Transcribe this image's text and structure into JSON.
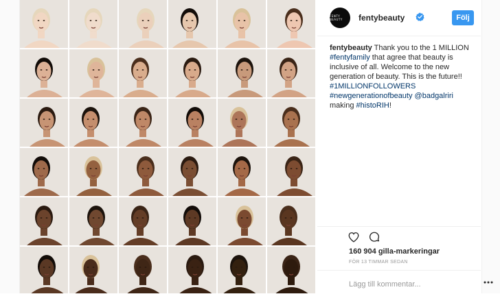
{
  "post": {
    "username": "fentybeauty",
    "avatar_text": "FENTY BEAUTY",
    "follow_label": "Följ",
    "caption": {
      "author": "fentybeauty",
      "segments": [
        {
          "text": " Thank you to the 1 MILLION ",
          "type": "text"
        },
        {
          "text": "#fentyfamily",
          "type": "tag"
        },
        {
          "text": " that agree that beauty is inclusive of all. Welcome to the new generation of beauty. This is the future!! ",
          "type": "text"
        },
        {
          "text": "#1MILLIONFOLLOWERS",
          "type": "tag"
        },
        {
          "text": " ",
          "type": "text"
        },
        {
          "text": "#newgenerationofbeauty",
          "type": "tag"
        },
        {
          "text": " ",
          "type": "text"
        },
        {
          "text": "@badgalriri",
          "type": "tag"
        },
        {
          "text": " making ",
          "type": "text"
        },
        {
          "text": "#histoRIH",
          "type": "tag"
        },
        {
          "text": "!",
          "type": "text"
        }
      ]
    },
    "likes": "160 904 gilla-markeringar",
    "time": "FÖR 13 TIMMAR SEDAN",
    "add_comment_placeholder": "Lägg till kommentar...",
    "more_icon": "more-dots-icon",
    "colors": {
      "accent": "#3897f0",
      "tag": "#003569",
      "verified": "#3897f0"
    }
  },
  "grid": {
    "rows": 6,
    "cols": 6,
    "tones": [
      [
        "#f1d7c3",
        "#f0dccc",
        "#ebd0bb",
        "#e6c7ad",
        "#e8c3a8",
        "#eec7b1"
      ],
      [
        "#dcb196",
        "#dfb59a",
        "#d9ad8d",
        "#d8aa8b",
        "#c89a7b",
        "#d2a385"
      ],
      [
        "#c79474",
        "#c48e6d",
        "#bf8867",
        "#b98162",
        "#ad7559",
        "#a9724f"
      ],
      [
        "#9e6a4b",
        "#94613f",
        "#8e5a3c",
        "#7a4e33",
        "#a46947",
        "#7d4c31"
      ],
      [
        "#6b432c",
        "#704830",
        "#643d26",
        "#5d3924",
        "#7b4a30",
        "#5a3620"
      ],
      [
        "#5a3824",
        "#4a2c1b",
        "#3f2616",
        "#3a2213",
        "#33200f",
        "#2e1b0e"
      ]
    ]
  }
}
